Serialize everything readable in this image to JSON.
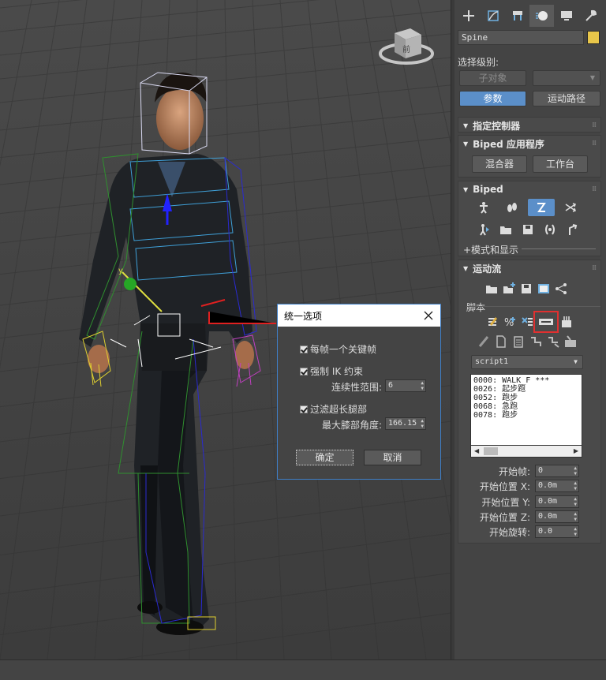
{
  "viewport": {
    "viewcube_label": "前"
  },
  "panel": {
    "tabs": [
      "create-icon",
      "modify-icon",
      "hierarchy-icon",
      "motion-icon",
      "display-icon",
      "utilities-icon"
    ],
    "object_name": "Spine",
    "object_color": "#e8c64a",
    "selection_level_label": "选择级别:",
    "sub_object_button": "子对象",
    "params_button": "参数",
    "trajectories_button": "运动路径",
    "rollout_assign_controller": "指定控制器",
    "rollout_biped_apps": "Biped 应用程序",
    "mixer_button": "混合器",
    "workbench_button": "工作台",
    "rollout_biped": "Biped",
    "mode_display": "+模式和显示",
    "rollout_motion_flow": "运动流",
    "scripts_label": "脚本",
    "script_dropdown_value": "script1",
    "script_list": [
      "0000: WALK_F  ***",
      "0026: 起步跑",
      "0052: 跑步",
      "0068: 急跑",
      "0078: 跑步"
    ],
    "start_frame_label": "开始帧:",
    "start_frame_value": "0",
    "start_pos_x_label": "开始位置 X:",
    "start_pos_x_value": "0.0m",
    "start_pos_y_label": "开始位置 Y:",
    "start_pos_y_value": "0.0m",
    "start_pos_z_label": "开始位置 Z:",
    "start_pos_z_value": "0.0m",
    "start_rot_label": "开始旋转:",
    "start_rot_value": "0.0",
    "accent_color": "#5b8fc9",
    "highlight_color": "#e03030"
  },
  "dialog": {
    "title": "统一选项",
    "opt_key_per_frame": "每帧一个关键帧",
    "opt_force_ik": "强制 IK 约束",
    "continuity_label": "连续性范围:",
    "continuity_value": "6",
    "opt_filter_legs": "过滤超长腿部",
    "max_knee_label": "最大膝部角度:",
    "max_knee_value": "166.15",
    "ok_button": "确定",
    "cancel_button": "取消"
  }
}
